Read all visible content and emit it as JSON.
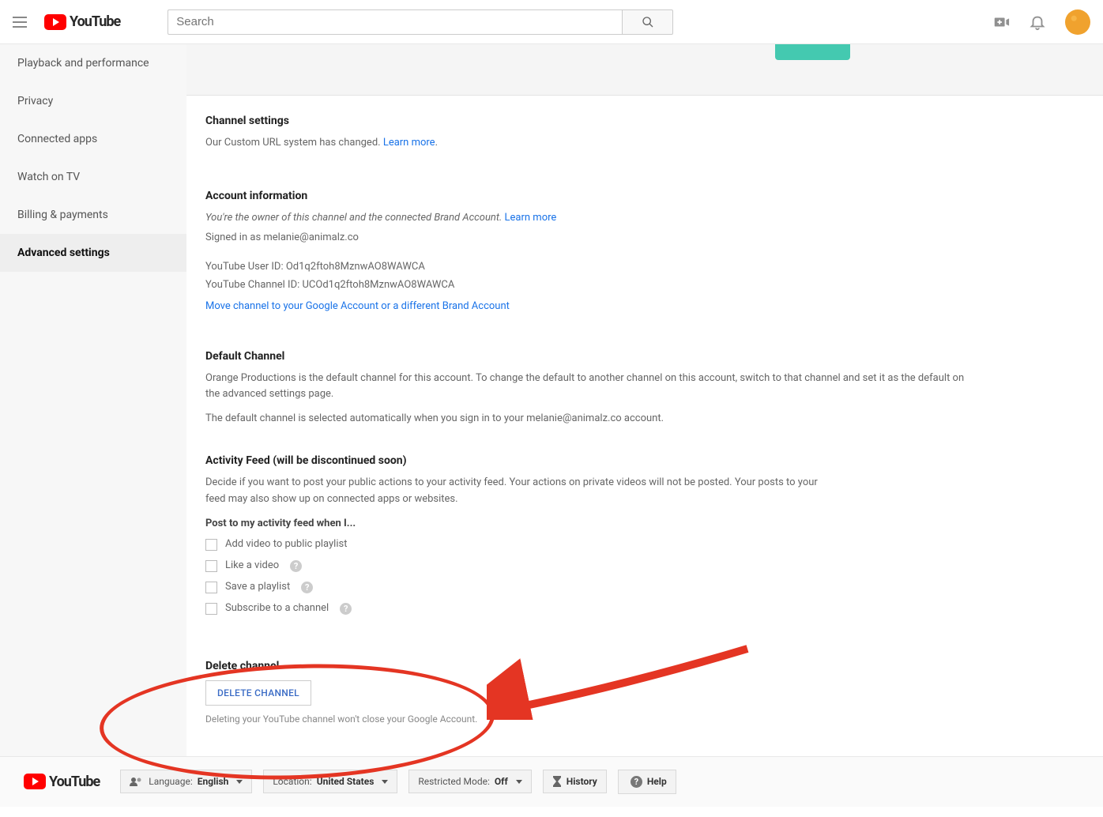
{
  "header": {
    "logo_text": "YouTube",
    "search_placeholder": "Search"
  },
  "sidebar": {
    "items": [
      {
        "label": "Playback and performance"
      },
      {
        "label": "Privacy"
      },
      {
        "label": "Connected apps"
      },
      {
        "label": "Watch on TV"
      },
      {
        "label": "Billing & payments"
      },
      {
        "label": "Advanced settings"
      }
    ]
  },
  "channel_settings": {
    "title": "Channel settings",
    "desc": "Our Custom URL system has changed. ",
    "learn_more": "Learn more"
  },
  "account_info": {
    "title": "Account information",
    "owner_text": "You're the owner of this channel and the connected Brand Account. ",
    "learn_more": "Learn more",
    "signed_in": "Signed in as melanie@animalz.co",
    "user_id": "YouTube User ID: Od1q2ftoh8MznwAO8WAWCA",
    "channel_id": "YouTube Channel ID: UCOd1q2ftoh8MznwAO8WAWCA",
    "move_link": "Move channel to your Google Account or a different Brand Account"
  },
  "default_channel": {
    "title": "Default Channel",
    "p1": "Orange Productions is the default channel for this account. To change the default to another channel on this account, switch to that channel and set it as the default on the advanced settings page.",
    "p2": "The default channel is selected automatically when you sign in to your melanie@animalz.co account."
  },
  "activity_feed": {
    "title": "Activity Feed (will be discontinued soon)",
    "desc": "Decide if you want to post your public actions to your activity feed. Your actions on private videos will not be posted. Your posts to your feed may also show up on connected apps or websites.",
    "post_label": "Post to my activity feed when I...",
    "options": [
      {
        "label": "Add video to public playlist",
        "help": false
      },
      {
        "label": "Like a video",
        "help": true
      },
      {
        "label": "Save a playlist",
        "help": true
      },
      {
        "label": "Subscribe to a channel",
        "help": true
      }
    ]
  },
  "delete_channel": {
    "title": "Delete channel",
    "button": "DELETE CHANNEL",
    "caption": "Deleting your YouTube channel won't close your Google Account."
  },
  "footer": {
    "logo_text": "YouTube",
    "language_label": "Language: ",
    "language_value": "English",
    "location_label": "Location: ",
    "location_value": "United States",
    "restricted_label": "Restricted Mode: ",
    "restricted_value": "Off",
    "history": "History",
    "help": "Help"
  }
}
